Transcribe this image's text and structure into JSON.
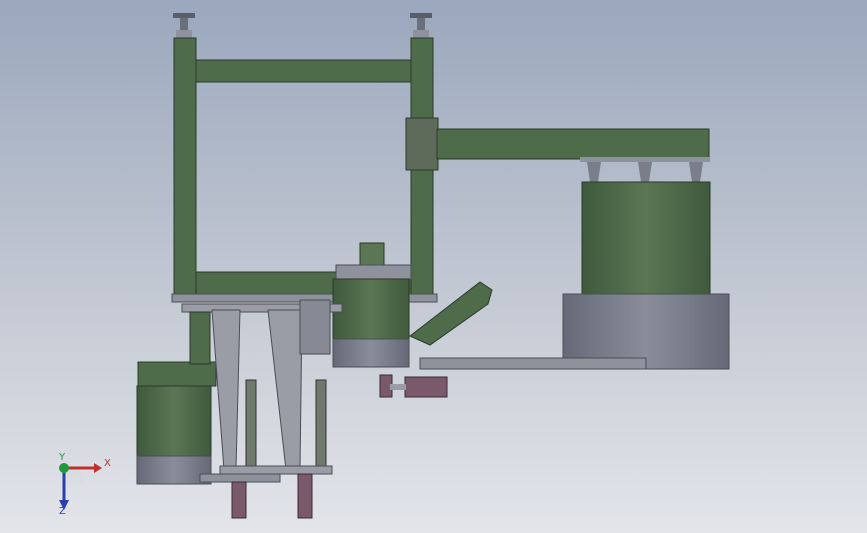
{
  "viewport": {
    "background_top": "#9aa7bc",
    "background_bottom": "#e3e5ea"
  },
  "model": {
    "colors": {
      "frame_green": "#4e6b4a",
      "frame_dark": "#2b3a2a",
      "tank_green": "#55704e",
      "base_grey": "#7a7d8a",
      "steel": "#8e929c",
      "cylinder_purple": "#7a5a6a"
    }
  },
  "triad": {
    "x_label": "X",
    "y_label": "Y",
    "z_label": "Z",
    "x_color": "#c0302a",
    "y_color": "#1f9a3a",
    "z_color": "#2a3fb0"
  }
}
